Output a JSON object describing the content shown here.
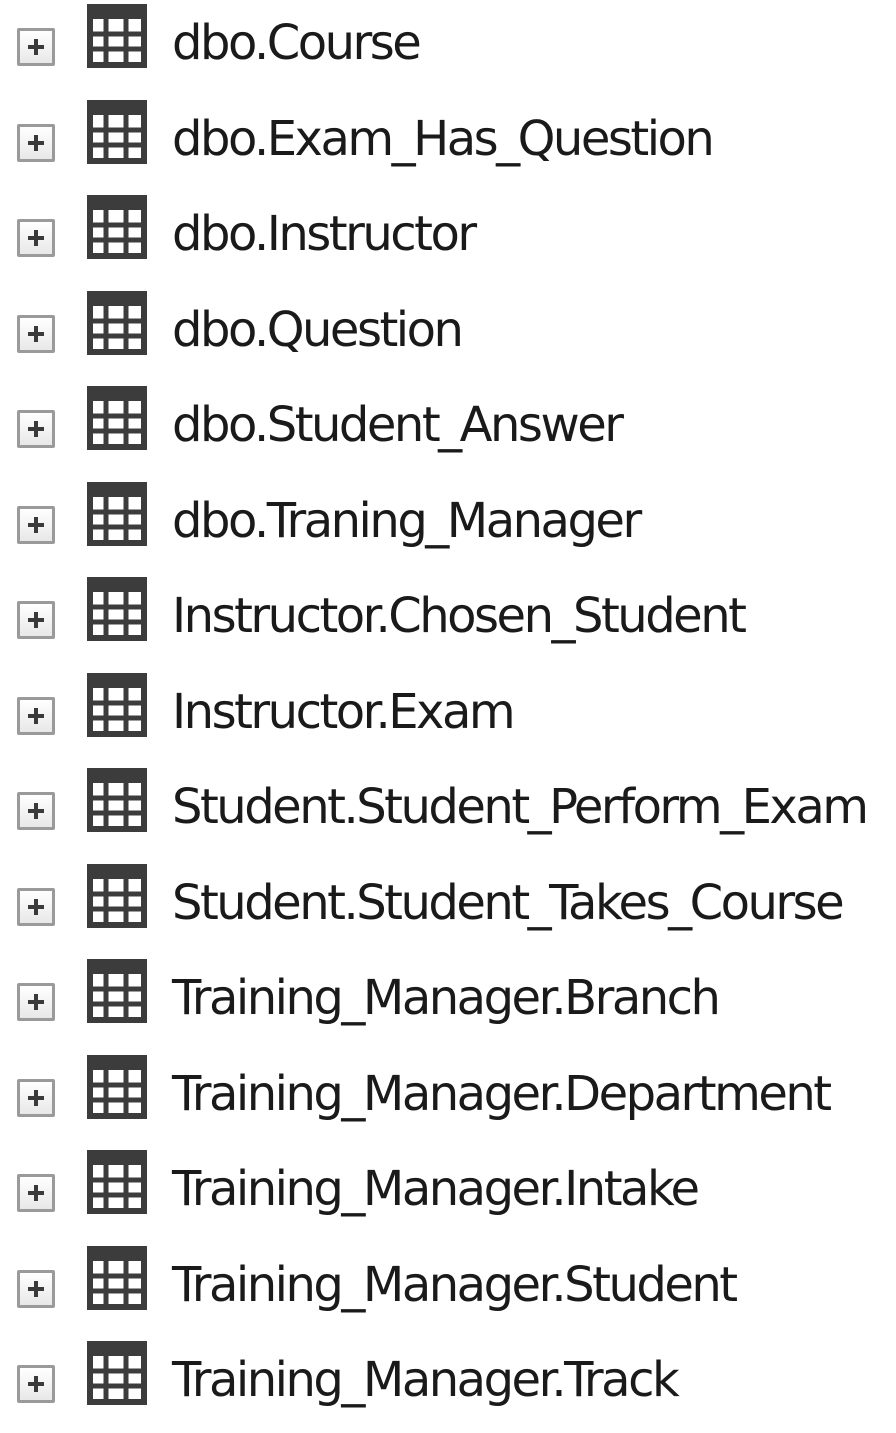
{
  "explorer": {
    "nodes": [
      {
        "label": "dbo.Course",
        "icon": "table-icon",
        "expander": "plus"
      },
      {
        "label": "dbo.Exam_Has_Question",
        "icon": "table-icon",
        "expander": "plus"
      },
      {
        "label": "dbo.Instructor",
        "icon": "table-icon",
        "expander": "plus"
      },
      {
        "label": "dbo.Question",
        "icon": "table-icon",
        "expander": "plus"
      },
      {
        "label": "dbo.Student_Answer",
        "icon": "table-icon",
        "expander": "plus"
      },
      {
        "label": "dbo.Traning_Manager",
        "icon": "table-icon",
        "expander": "plus"
      },
      {
        "label": "Instructor.Chosen_Student",
        "icon": "table-icon",
        "expander": "plus"
      },
      {
        "label": "Instructor.Exam",
        "icon": "table-icon",
        "expander": "plus"
      },
      {
        "label": "Student.Student_Perform_Exam",
        "icon": "table-icon",
        "expander": "plus"
      },
      {
        "label": "Student.Student_Takes_Course",
        "icon": "table-icon",
        "expander": "plus"
      },
      {
        "label": "Training_Manager.Branch",
        "icon": "table-icon",
        "expander": "plus"
      },
      {
        "label": "Training_Manager.Department",
        "icon": "table-icon",
        "expander": "plus"
      },
      {
        "label": "Training_Manager.Intake",
        "icon": "table-icon",
        "expander": "plus"
      },
      {
        "label": "Training_Manager.Student",
        "icon": "table-icon",
        "expander": "plus"
      },
      {
        "label": "Training_Manager.Track",
        "icon": "table-icon",
        "expander": "plus"
      }
    ]
  },
  "colors": {
    "text": "#1a1a1a",
    "icon": "#3c3c3c",
    "expander_border": "#9a9a9a",
    "background": "#ffffff"
  }
}
